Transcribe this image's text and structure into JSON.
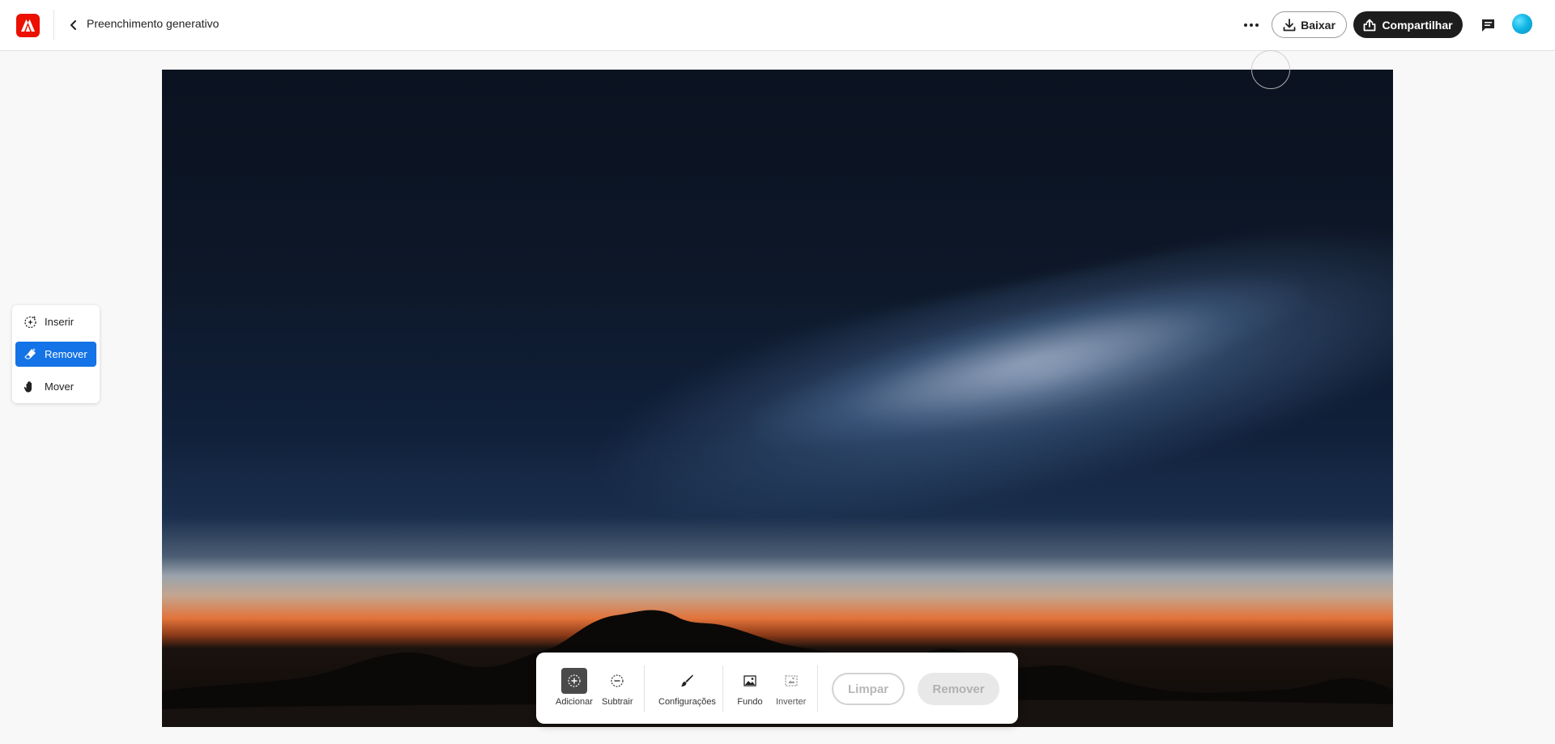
{
  "header": {
    "title": "Preenchimento generativo",
    "download_label": "Baixar",
    "share_label": "Compartilhar"
  },
  "tools": [
    {
      "label": "Inserir",
      "icon": "insert-sparkle-icon",
      "active": false
    },
    {
      "label": "Remover",
      "icon": "eraser-icon",
      "active": true
    },
    {
      "label": "Mover",
      "icon": "hand-icon",
      "active": false
    }
  ],
  "toolbar": {
    "add_label": "Adicionar",
    "subtract_label": "Subtrair",
    "settings_label": "Configurações",
    "background_label": "Fundo",
    "invert_label": "Inverter",
    "clear_label": "Limpar",
    "remove_label": "Remover"
  },
  "colors": {
    "brand": "#eb1000",
    "accent": "#1473e6",
    "share_bg": "#1d1d1d"
  }
}
